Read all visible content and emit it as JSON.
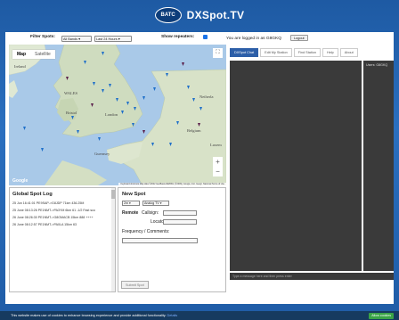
{
  "header": {
    "logo_text": "BATC",
    "title": "DXSpot.TV"
  },
  "filters": {
    "label": "Filter Spots:",
    "bands": "All Bands",
    "time": "Last 24 Hours",
    "repeaters_label": "Show repeaters:"
  },
  "session": {
    "login_text": "You are logged in as G8GKQ",
    "logout": "Logout"
  },
  "map": {
    "tab_map": "Map",
    "tab_satellite": "Satellite",
    "zoom_in": "+",
    "zoom_out": "−",
    "credit": "Keyboard shortcuts  Map data ©2022 GeoBasis-DE/BKG (©2009), Google, Inst. Geogr. Nacional  Terms of Use",
    "google": "Google",
    "labels": {
      "ireland": "Ireland",
      "wales": "WALES",
      "netherlands": "Netherla",
      "belgium": "Belgium",
      "guernsey": "Guernsey",
      "luxem": "Luxem",
      "bristol": "Bristol",
      "london": "London"
    }
  },
  "spot_log": {
    "title": "Global Spot Log",
    "entries": [
      "25 Jun 16:41:01  PE9SAP->G8JDP 71km 436.25M",
      "25 June 08:13:26  PE1NMT->PA3YM 6km 61 -1/2 Fast sco",
      "26 June 08:26:30  PE1NMT->G8GMACB 15km 888 ++++",
      "26 June 08:12:57  PE1NMT->PA0LA 15km 63"
    ]
  },
  "new_spot": {
    "title": "New Spot",
    "band": "2m",
    "mode": "Analog TV",
    "remote_label": "Remote",
    "callsign_label": "Callsign:",
    "locator_label": "Locator:",
    "freq_label": "Frequency / Comments:",
    "submit": "Submit Spot"
  },
  "chat": {
    "tabs": [
      "DXSpot Chat",
      "Edit My Station",
      "Find Station",
      "Help",
      "About"
    ],
    "users": [
      "Users: G8GKQ"
    ],
    "input_placeholder": "Type a message here and then press enter"
  },
  "cookie": {
    "text": "This website makes use of cookies to enhance browsing experience and provide additional functionality.",
    "link": "Details",
    "button": "Allow cookies"
  },
  "colors": {
    "accent": "#2d5fa8",
    "chat_bg": "#3a3a3a",
    "cookie_btn": "#3aa347"
  }
}
